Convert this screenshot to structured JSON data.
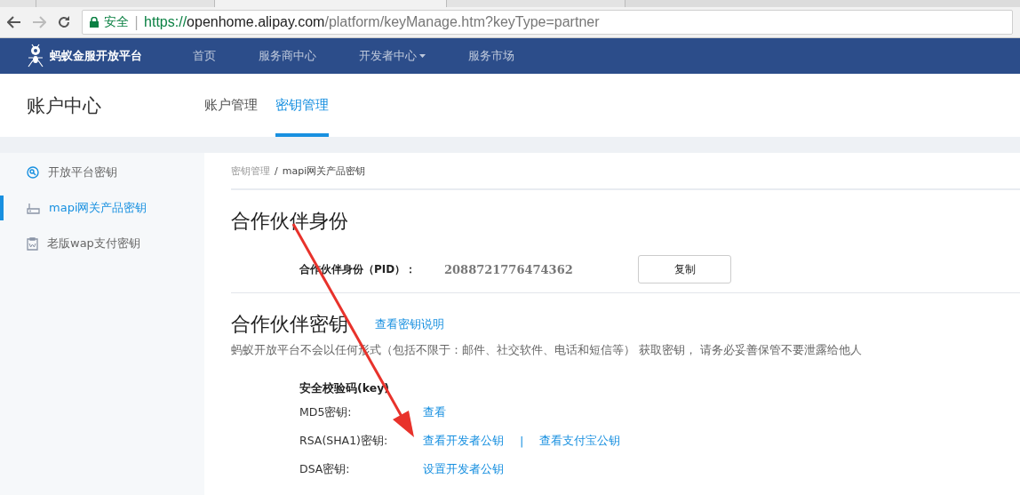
{
  "browser": {
    "tabs": [
      {
        "selected": false
      },
      {
        "selected": false
      },
      {
        "selected": true
      },
      {
        "selected": false
      }
    ],
    "security": "安全",
    "separator": "|",
    "url": {
      "scheme": "https://",
      "host": "openhome.alipay.com",
      "path": "/platform/keyManage.htm?keyType=partner"
    }
  },
  "topnav": {
    "brand": "蚂蚁金服开放平台",
    "items": [
      {
        "label": "首页",
        "dropdown": false
      },
      {
        "label": "服务商中心",
        "dropdown": false
      },
      {
        "label": "开发者中心",
        "dropdown": true
      },
      {
        "label": "服务市场",
        "dropdown": false
      }
    ]
  },
  "header": {
    "title": "账户中心",
    "tabs": [
      {
        "label": "账户管理",
        "selected": false
      },
      {
        "label": "密钥管理",
        "selected": true
      }
    ]
  },
  "sidebar": {
    "items": [
      {
        "label": "开放平台密钥",
        "selected": false
      },
      {
        "label": "mapi网关产品密钥",
        "selected": true
      },
      {
        "label": "老版wap支付密钥",
        "selected": false
      }
    ]
  },
  "breadcrumb": {
    "parent": "密钥管理",
    "separator": "/",
    "current": "mapi网关产品密钥"
  },
  "identity": {
    "heading": "合作伙伴身份",
    "label": "合作伙伴身份（PID）：",
    "value": "2088721776474362",
    "button": "复制"
  },
  "keys": {
    "heading": "合作伙伴密钥",
    "help_link": "查看密钥说明",
    "notice": "蚂蚁开放平台不会以任何形式（包括不限于：邮件、社交软件、电话和短信等） 获取密钥， 请务必妥善保管不要泄露给他人",
    "section_title": "安全校验码(key)",
    "rows": [
      {
        "label": "MD5密钥:",
        "links": [
          "查看"
        ]
      },
      {
        "label": "RSA(SHA1)密钥:",
        "links": [
          "查看开发者公钥",
          "查看支付宝公钥"
        ],
        "divider": "|"
      },
      {
        "label": "DSA密钥:",
        "links": [
          "设置开发者公钥"
        ]
      }
    ]
  }
}
